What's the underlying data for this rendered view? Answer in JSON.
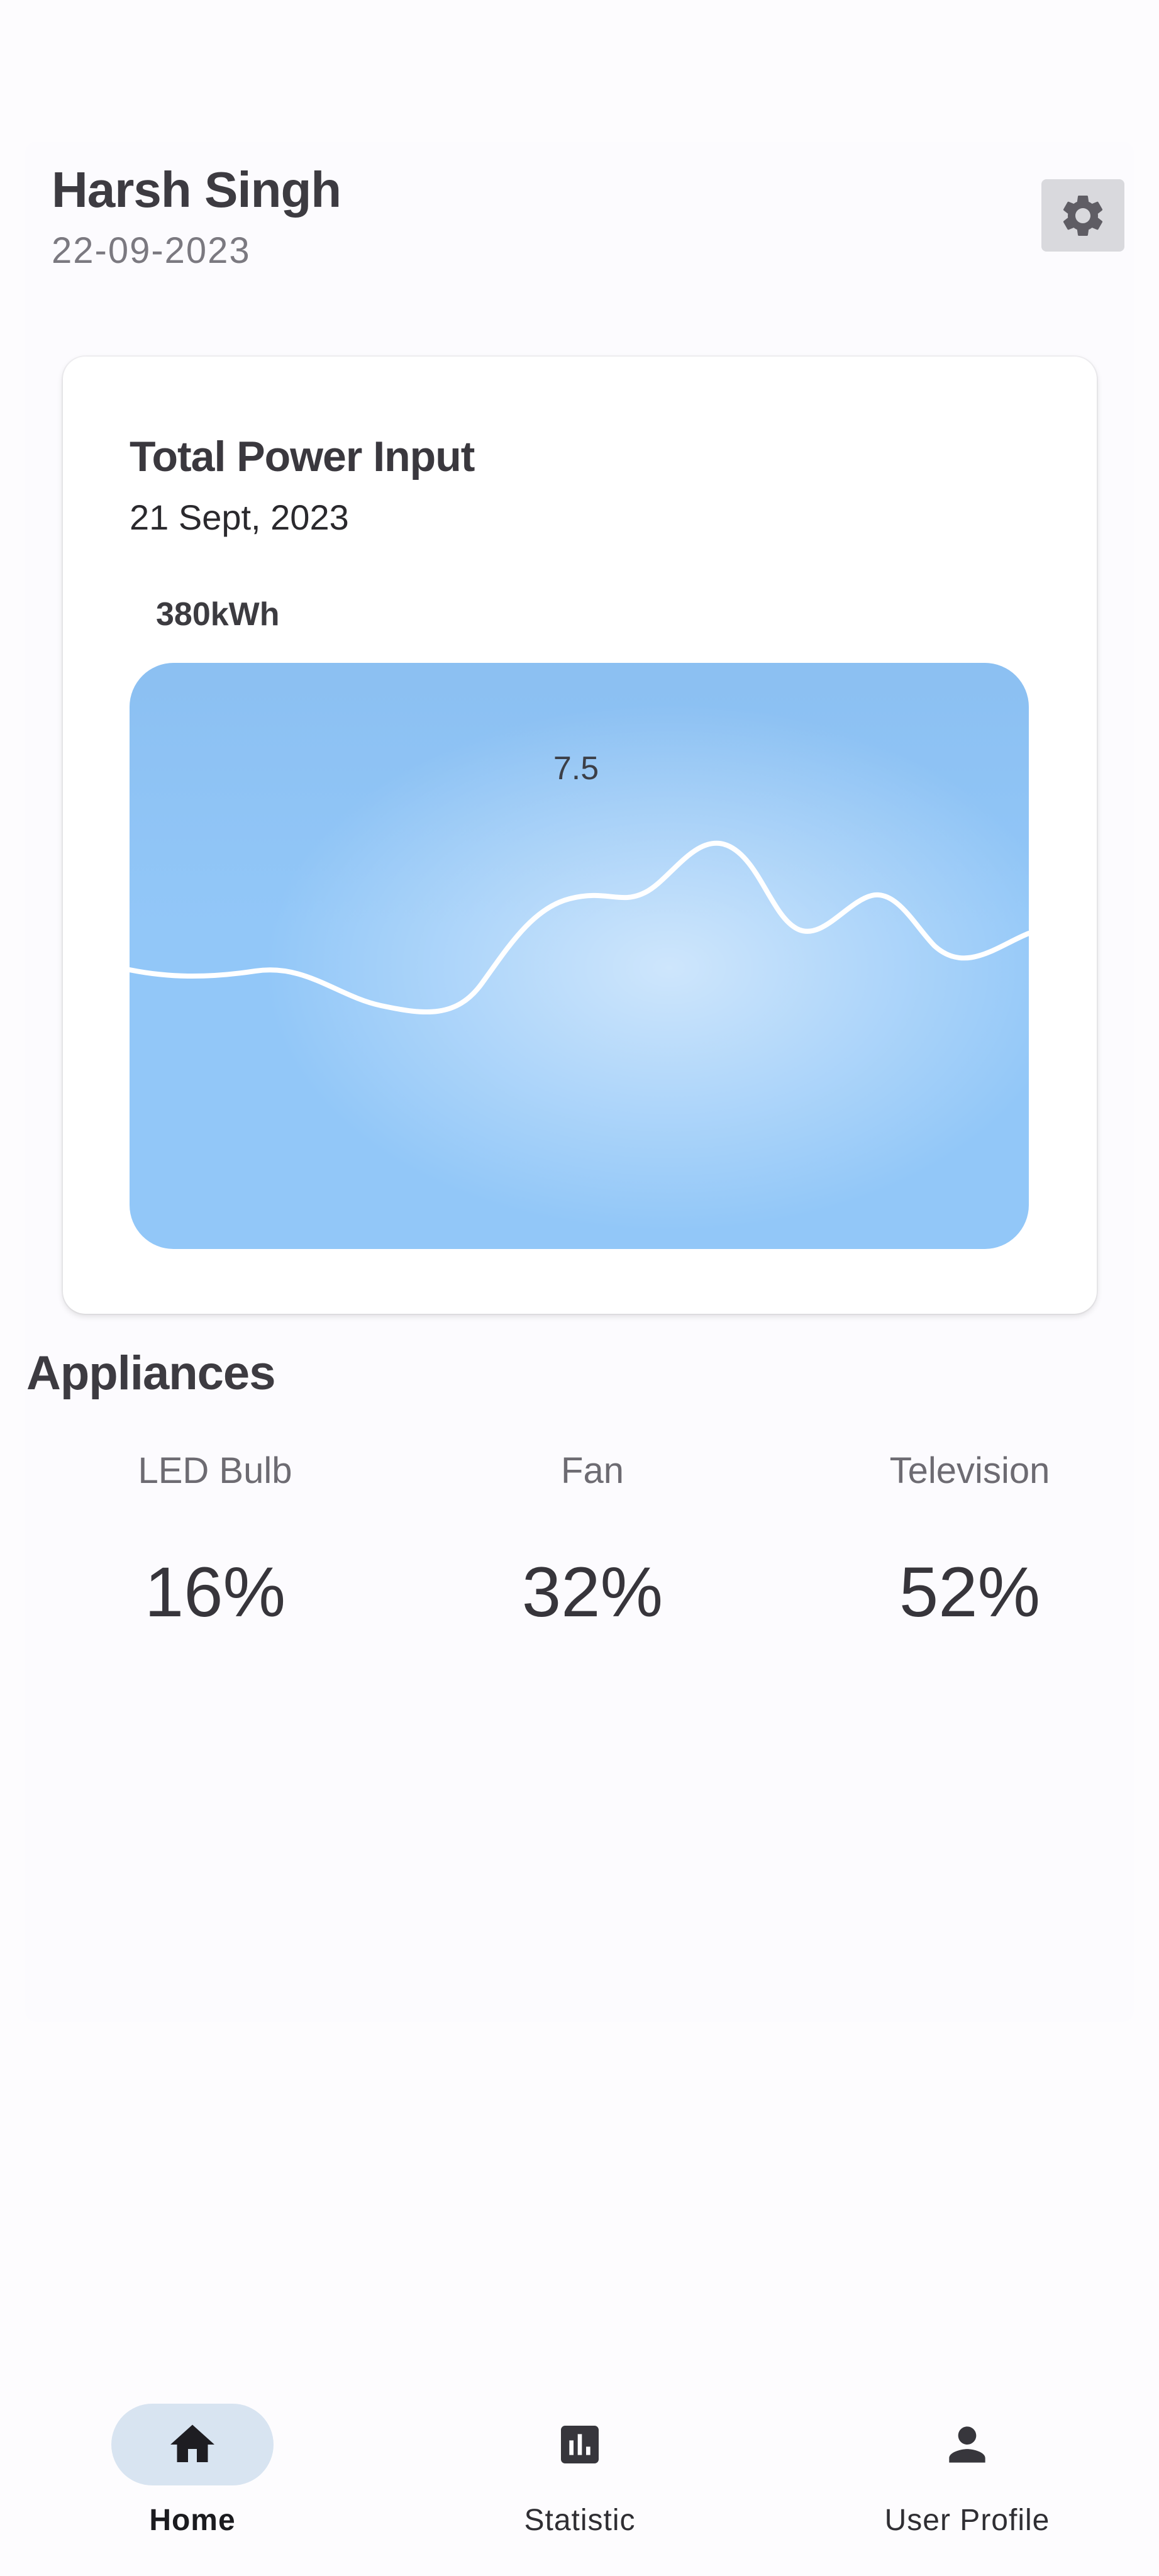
{
  "header": {
    "user_name": "Harsh Singh",
    "date": "22-09-2023"
  },
  "settings": {
    "icon": "gear-icon"
  },
  "power_card": {
    "title": "Total Power Input",
    "date": "21 Sept, 2023",
    "total": "380kWh",
    "peak_label": "7.5",
    "colors": {
      "area": "#92c7f8",
      "line": "#ffffff"
    }
  },
  "appliances": {
    "title": "Appliances",
    "items": [
      {
        "name": "LED Bulb",
        "value": "16%"
      },
      {
        "name": "Fan",
        "value": "32%"
      },
      {
        "name": "Television",
        "value": "52%"
      }
    ]
  },
  "nav": {
    "items": [
      {
        "label": "Home",
        "icon": "home-icon",
        "active": true
      },
      {
        "label": "Statistic",
        "icon": "bar-chart-icon",
        "active": false
      },
      {
        "label": "User Profile",
        "icon": "person-icon",
        "active": false
      }
    ]
  }
}
